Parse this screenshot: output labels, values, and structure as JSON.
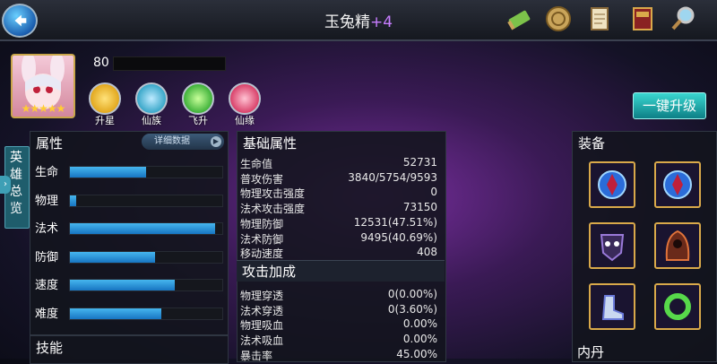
{
  "header": {
    "name": "玉兔精",
    "plus": "+4"
  },
  "hero": {
    "level": "80",
    "stars": "★★★★★"
  },
  "skills": [
    {
      "label": "升星",
      "color": "#e2a81f"
    },
    {
      "label": "仙族",
      "color": "#39a7c9"
    },
    {
      "label": "飞升",
      "color": "#3fb23a"
    },
    {
      "label": "仙缘",
      "color": "#d9416a"
    }
  ],
  "upgrade_button": "一键升级",
  "side_tab": "英雄总览",
  "attributes": {
    "title": "属性",
    "detail_button": "详细数据",
    "rows": [
      {
        "name": "生命",
        "fill": 0.5
      },
      {
        "name": "物理",
        "fill": 0.04
      },
      {
        "name": "法术",
        "fill": 0.95
      },
      {
        "name": "防御",
        "fill": 0.56
      },
      {
        "name": "速度",
        "fill": 0.69
      },
      {
        "name": "难度",
        "fill": 0.6
      }
    ]
  },
  "skills_panel_title": "技能",
  "base_attributes": {
    "title": "基础属性",
    "rows": [
      {
        "k": "生命值",
        "v": "52731"
      },
      {
        "k": "普攻伤害",
        "v": "3840/5754/9593"
      },
      {
        "k": "物理攻击强度",
        "v": "0"
      },
      {
        "k": "法术攻击强度",
        "v": "73150"
      },
      {
        "k": "物理防御",
        "v": "12531(47.51%)"
      },
      {
        "k": "法术防御",
        "v": "9495(40.69%)"
      },
      {
        "k": "移动速度",
        "v": "408"
      }
    ]
  },
  "attack_bonus": {
    "title": "攻击加成",
    "rows": [
      {
        "k": "物理穿透",
        "v": "0(0.00%)"
      },
      {
        "k": "法术穿透",
        "v": "0(3.60%)"
      },
      {
        "k": "物理吸血",
        "v": "0.00%"
      },
      {
        "k": "法术吸血",
        "v": "0.00%"
      },
      {
        "k": "暴击率",
        "v": "45.00%"
      }
    ]
  },
  "equipment": {
    "title": "装备",
    "inner_title": "内丹"
  }
}
